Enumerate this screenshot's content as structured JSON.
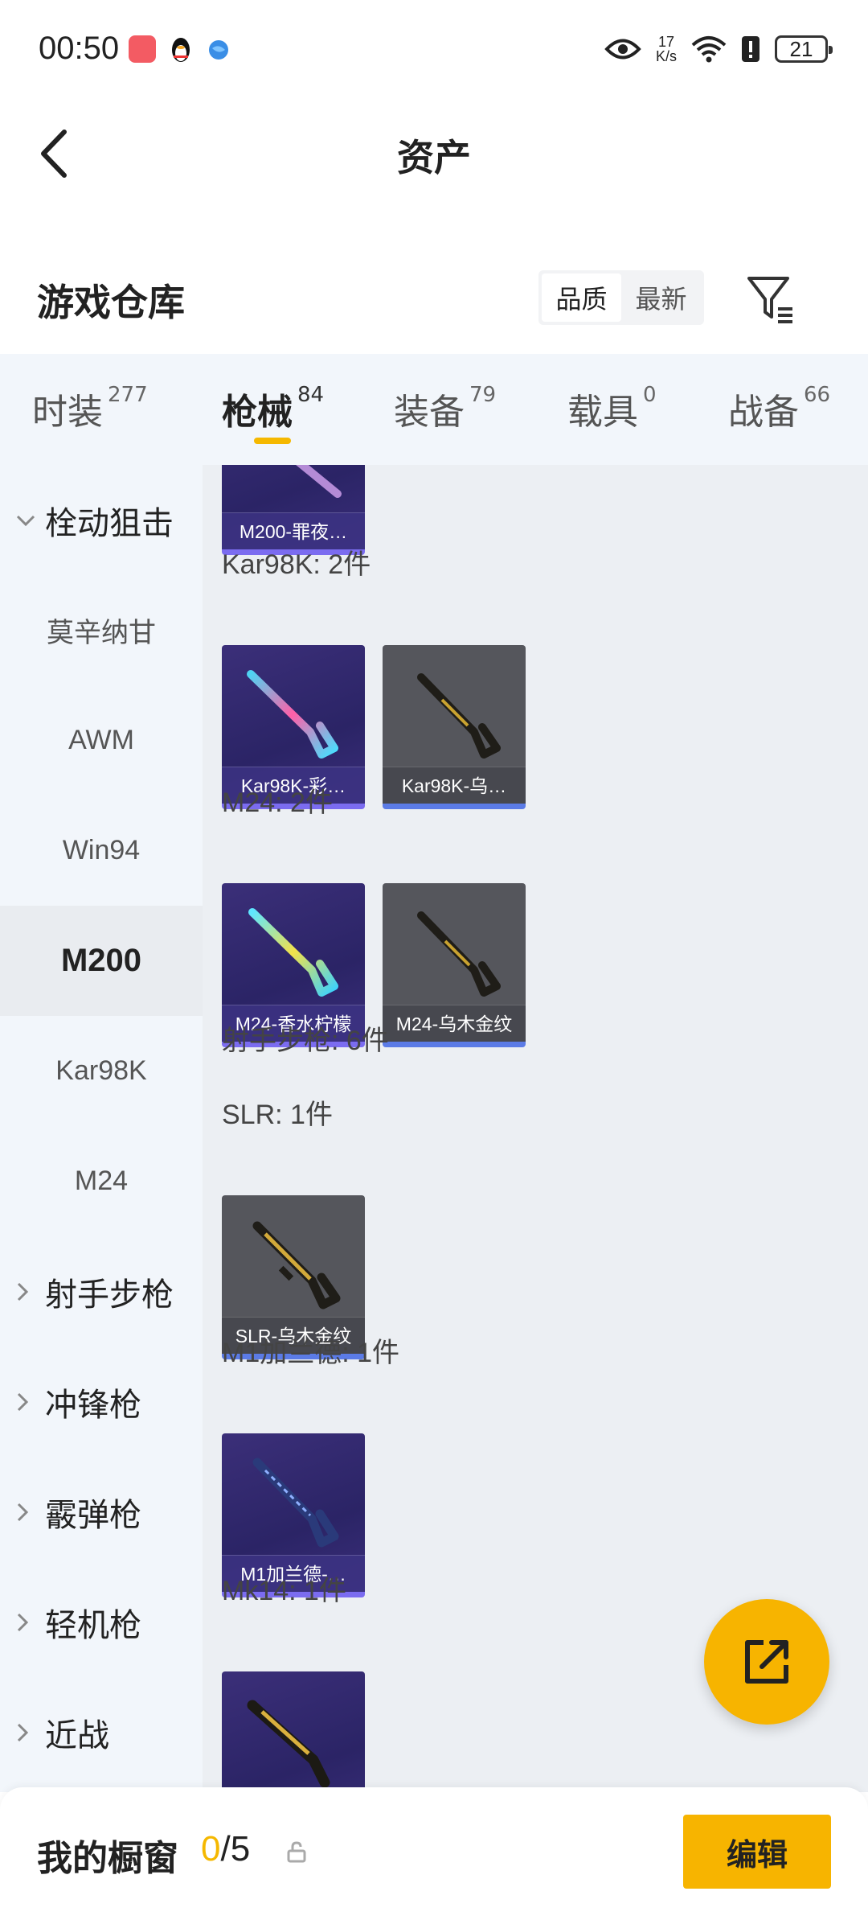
{
  "status_bar": {
    "time": "00:50",
    "speed_value": "17",
    "speed_unit": "K/s",
    "battery": "21",
    "icons": [
      "app-red-icon",
      "qq-penguin-icon",
      "blue-ball-icon",
      "eye-icon",
      "wifi-icon",
      "alert-icon",
      "battery-icon"
    ]
  },
  "header": {
    "title": "资产",
    "back_icon": "chevron-left-icon"
  },
  "warehouse": {
    "title": "游戏仓库",
    "sort_options": [
      "品质",
      "最新"
    ],
    "active_sort": "品质",
    "filter_icon": "filter-icon"
  },
  "tabs": [
    {
      "label": "时装",
      "count": "277"
    },
    {
      "label": "枪械",
      "count": "84",
      "active": true
    },
    {
      "label": "装备",
      "count": "79"
    },
    {
      "label": "载具",
      "count": "0"
    },
    {
      "label": "战备",
      "count": "66"
    }
  ],
  "sidebar": {
    "items": [
      {
        "label": "栓动狙击",
        "type": "group",
        "expanded": true
      },
      {
        "label": "莫辛纳甘"
      },
      {
        "label": "AWM"
      },
      {
        "label": "Win94"
      },
      {
        "label": "M200",
        "active": true
      },
      {
        "label": "Kar98K"
      },
      {
        "label": "M24"
      },
      {
        "label": "射手步枪",
        "type": "group"
      },
      {
        "label": "冲锋枪",
        "type": "group"
      },
      {
        "label": "霰弹枪",
        "type": "group"
      },
      {
        "label": "轻机枪",
        "type": "group"
      },
      {
        "label": "近战",
        "type": "group"
      }
    ]
  },
  "main": {
    "sections": [
      {
        "label": "Kar98K: 2件"
      },
      {
        "label": "M24: 2件"
      },
      {
        "label": "射手步枪: 6件"
      },
      {
        "label": "SLR: 1件"
      },
      {
        "label": "M1加兰德: 1件"
      },
      {
        "label": "Mk14: 1件"
      }
    ],
    "cards": [
      {
        "name": "M200-罪夜…",
        "quality": "purple"
      },
      {
        "name": "Kar98K-彩…",
        "quality": "purple"
      },
      {
        "name": "Kar98K-乌…",
        "quality": "gray"
      },
      {
        "name": "M24-香水柠檬",
        "quality": "purple"
      },
      {
        "name": "M24-乌木金纹",
        "quality": "gray"
      },
      {
        "name": "SLR-乌木金纹",
        "quality": "gray"
      },
      {
        "name": "M1加兰德-…",
        "quality": "purple"
      },
      {
        "name": "",
        "quality": "purple"
      }
    ]
  },
  "fab": {
    "icon": "share-external-icon"
  },
  "bottom_bar": {
    "title": "我的橱窗",
    "current": "0",
    "total": "/5",
    "lock_icon": "lock-icon",
    "edit_label": "编辑"
  },
  "colors": {
    "accent": "#f7b400",
    "purple_card": "#2b2466",
    "gray_card": "#55565c",
    "sidebar_bg": "#f2f6fb",
    "content_bg": "#eceff3"
  }
}
